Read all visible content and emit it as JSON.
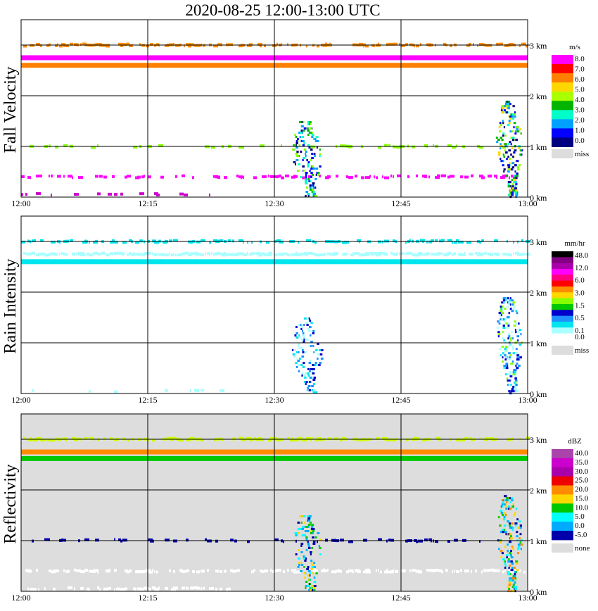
{
  "title": "2020-08-25   12:00-13:00 UTC",
  "chart_data": [
    {
      "type": "heatmap",
      "ylabel": "Fall Velocity",
      "xticks": [
        "12:00",
        "12:15",
        "12:30",
        "12:45",
        "13:00"
      ],
      "yticks": [
        "0 km",
        "1 km",
        "2 km",
        "3 km"
      ],
      "ylim": [
        0,
        3.5
      ],
      "background": "#ffffff",
      "grid": true,
      "colorbar": {
        "unit": "m/s",
        "levels": [
          "8.0",
          "7.0",
          "6.0",
          "5.0",
          "4.0",
          "3.0",
          "2.0",
          "1.0",
          "0.0"
        ],
        "colors": [
          "#ff00ff",
          "#ff0000",
          "#ff7f00",
          "#ffd700",
          "#aaff00",
          "#00b400",
          "#00ffc8",
          "#00a0ff",
          "#0000ff",
          "#000080"
        ],
        "miss_label": "miss",
        "miss_color": "#dddddd"
      },
      "bands": [
        {
          "height_km": 3.0,
          "t_start": 0,
          "t_end": 60,
          "color": "#ff8c00",
          "density": 0.55
        },
        {
          "height_km": 2.75,
          "t_start": 0,
          "t_end": 60,
          "color": "#ff00ff",
          "density": 1.0
        },
        {
          "height_km": 2.6,
          "t_start": 0,
          "t_end": 60,
          "color": "#ff7f00",
          "density": 1.0
        },
        {
          "height_km": 1.0,
          "t_start": 0,
          "t_end": 60,
          "color": "#88ff00",
          "density": 0.2
        },
        {
          "height_km": 0.4,
          "t_start": 0,
          "t_end": 60,
          "color": "#ff00ff",
          "density": 0.4
        },
        {
          "height_km": 0.05,
          "t_start": 0,
          "t_end": 25,
          "color": "#cc00cc",
          "density": 0.15
        }
      ],
      "cells": [
        {
          "t_center": 33.5,
          "top_km": 1.5,
          "width_min": 3.5,
          "colors": [
            "#0000ff",
            "#00a0ff",
            "#00ffc8",
            "#00b400",
            "#88ff00",
            "#000080"
          ]
        },
        {
          "t_center": 57.5,
          "top_km": 1.9,
          "width_min": 3.0,
          "colors": [
            "#0000ff",
            "#00a0ff",
            "#00ffc8",
            "#00b400",
            "#88ff00",
            "#ffd700",
            "#000080"
          ]
        }
      ]
    },
    {
      "type": "heatmap",
      "ylabel": "Rain Intensity",
      "xticks": [
        "12:00",
        "12:15",
        "12:30",
        "12:45",
        "13:00"
      ],
      "yticks": [
        "0 km",
        "1 km",
        "2 km",
        "3 km"
      ],
      "ylim": [
        0,
        3.5
      ],
      "background": "#ffffff",
      "grid": true,
      "colorbar": {
        "unit": "mm/hr",
        "levels": [
          "48.0",
          "",
          "12.0",
          "",
          "6.0",
          "",
          "3.0",
          "",
          "1.5",
          "",
          "0.5",
          "",
          "0.1",
          "0.0"
        ],
        "colors": [
          "#000000",
          "#800080",
          "#aa00aa",
          "#ff00ff",
          "#ff0080",
          "#ff0000",
          "#ff8c00",
          "#ffd700",
          "#88ff00",
          "#00c800",
          "#0000cd",
          "#1e90ff",
          "#00e5ee",
          "#aaffff",
          "#ffffff"
        ],
        "miss_label": "miss",
        "miss_color": "#dddddd"
      },
      "bands": [
        {
          "height_km": 3.0,
          "t_start": 0,
          "t_end": 60,
          "color": "#00e5ee",
          "density": 0.5
        },
        {
          "height_km": 2.75,
          "t_start": 0,
          "t_end": 60,
          "color": "#aaffff",
          "density": 0.9
        },
        {
          "height_km": 2.6,
          "t_start": 0,
          "t_end": 60,
          "color": "#00e5ee",
          "density": 1.0
        },
        {
          "height_km": 0.05,
          "t_start": 0,
          "t_end": 25,
          "color": "#aaffff",
          "density": 0.1
        }
      ],
      "cells": [
        {
          "t_center": 33.5,
          "top_km": 1.5,
          "width_min": 3.5,
          "colors": [
            "#aaffff",
            "#00e5ee",
            "#1e90ff",
            "#0000cd"
          ]
        },
        {
          "t_center": 57.5,
          "top_km": 1.9,
          "width_min": 3.0,
          "colors": [
            "#aaffff",
            "#00e5ee",
            "#1e90ff",
            "#0000cd",
            "#88ff00"
          ]
        }
      ]
    },
    {
      "type": "heatmap",
      "ylabel": "Reflectivity",
      "xticks": [
        "12:00",
        "12:15",
        "12:30",
        "12:45",
        "13:00"
      ],
      "yticks": [
        "0 km",
        "1 km",
        "2 km",
        "3 km"
      ],
      "ylim": [
        0,
        3.5
      ],
      "background": "#dddddd",
      "grid": true,
      "colorbar": {
        "unit": "dBZ",
        "levels": [
          "40.0",
          "35.0",
          "30.0",
          "25.0",
          "20.0",
          "15.0",
          "10.0",
          "5.0",
          "0.0",
          "-5.0"
        ],
        "colors": [
          "#aa44aa",
          "#cc00cc",
          "#aa00aa",
          "#ee0000",
          "#ff8c00",
          "#ffd700",
          "#00c800",
          "#00ffff",
          "#00aaff",
          "#0000aa"
        ],
        "miss_label": "none",
        "miss_color": "#dddddd"
      },
      "bands": [
        {
          "height_km": 3.0,
          "t_start": 0,
          "t_end": 60,
          "color": "#ccff00",
          "density": 0.6
        },
        {
          "height_km": 2.75,
          "t_start": 0,
          "t_end": 60,
          "color": "#ff8c00",
          "density": 1.0
        },
        {
          "height_km": 2.62,
          "t_start": 0,
          "t_end": 60,
          "color": "#00c800",
          "density": 1.0
        },
        {
          "height_km": 1.0,
          "t_start": 0,
          "t_end": 60,
          "color": "#0000aa",
          "density": 0.2
        },
        {
          "height_km": 0.4,
          "t_start": 0,
          "t_end": 60,
          "color": "#ffffff",
          "density": 0.55
        },
        {
          "height_km": 0.05,
          "t_start": 0,
          "t_end": 25,
          "color": "#ffffff",
          "density": 0.5
        }
      ],
      "cells": [
        {
          "t_center": 33.5,
          "top_km": 1.5,
          "width_min": 3.5,
          "colors": [
            "#0000aa",
            "#00aaff",
            "#00ffff",
            "#00c800",
            "#ffd700"
          ]
        },
        {
          "t_center": 57.5,
          "top_km": 1.9,
          "width_min": 3.0,
          "colors": [
            "#0000aa",
            "#00aaff",
            "#00ffff",
            "#00c800",
            "#ffd700",
            "#ff8c00"
          ]
        }
      ]
    }
  ]
}
